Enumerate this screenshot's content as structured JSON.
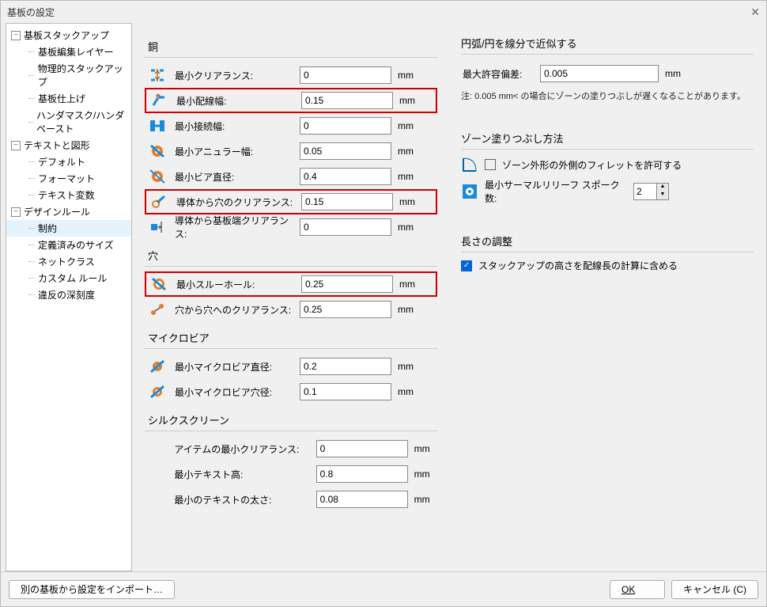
{
  "window": {
    "title": "基板の設定"
  },
  "tree": {
    "groups": [
      {
        "label": "基板スタックアップ",
        "children": [
          "基板編集レイヤー",
          "物理的スタックアップ",
          "基板仕上げ",
          "ハンダマスク/ハンダペースト"
        ]
      },
      {
        "label": "テキストと図形",
        "children": [
          "デフォルト",
          "フォーマット",
          "テキスト変数"
        ]
      },
      {
        "label": "デザインルール",
        "children": [
          "制約",
          "定義済みのサイズ",
          "ネットクラス",
          "カスタム ルール",
          "違反の深刻度"
        ]
      }
    ]
  },
  "sections": {
    "copper": {
      "title": "銅",
      "rows": [
        {
          "label": "最小クリアランス:",
          "value": "0",
          "unit": "mm",
          "hl": false
        },
        {
          "label": "最小配線幅:",
          "value": "0.15",
          "unit": "mm",
          "hl": true
        },
        {
          "label": "最小接続幅:",
          "value": "0",
          "unit": "mm",
          "hl": false
        },
        {
          "label": "最小アニュラー幅:",
          "value": "0.05",
          "unit": "mm",
          "hl": false
        },
        {
          "label": "最小ビア直径:",
          "value": "0.4",
          "unit": "mm",
          "hl": false
        },
        {
          "label": "導体から穴のクリアランス:",
          "value": "0.15",
          "unit": "mm",
          "hl": true
        },
        {
          "label": "導体から基板端クリアランス:",
          "value": "0",
          "unit": "mm",
          "hl": false
        }
      ]
    },
    "hole": {
      "title": "穴",
      "rows": [
        {
          "label": "最小スルーホール:",
          "value": "0.25",
          "unit": "mm",
          "hl": true
        },
        {
          "label": "穴から穴へのクリアランス:",
          "value": "0.25",
          "unit": "mm",
          "hl": false
        }
      ]
    },
    "uvia": {
      "title": "マイクロビア",
      "rows": [
        {
          "label": "最小マイクロビア直径:",
          "value": "0.2",
          "unit": "mm",
          "hl": false
        },
        {
          "label": "最小マイクロビア穴径:",
          "value": "0.1",
          "unit": "mm",
          "hl": false
        }
      ]
    },
    "silk": {
      "title": "シルクスクリーン",
      "rows": [
        {
          "label": "アイテムの最小クリアランス:",
          "value": "0",
          "unit": "mm"
        },
        {
          "label": "最小テキスト高:",
          "value": "0.8",
          "unit": "mm"
        },
        {
          "label": "最小のテキストの太さ:",
          "value": "0.08",
          "unit": "mm"
        }
      ]
    }
  },
  "right": {
    "arc": {
      "title": "円弧/円を線分で近似する",
      "label": "最大許容偏差:",
      "value": "0.005",
      "unit": "mm",
      "note": "注: 0.005 mm< の場合にゾーンの塗りつぶしが遅くなることがあります。"
    },
    "zone": {
      "title": "ゾーン塗りつぶし方法",
      "fillet": "ゾーン外形の外側のフィレットを許可する",
      "thermal": "最小サーマルリリーフ スポーク数:",
      "thermal_value": "2"
    },
    "length": {
      "title": "長さの調整",
      "stackup": "スタックアップの高さを配線長の計算に含める"
    }
  },
  "footer": {
    "import": "別の基板から設定をインポート…",
    "ok": "OK",
    "cancel": "キャンセル (C)"
  }
}
